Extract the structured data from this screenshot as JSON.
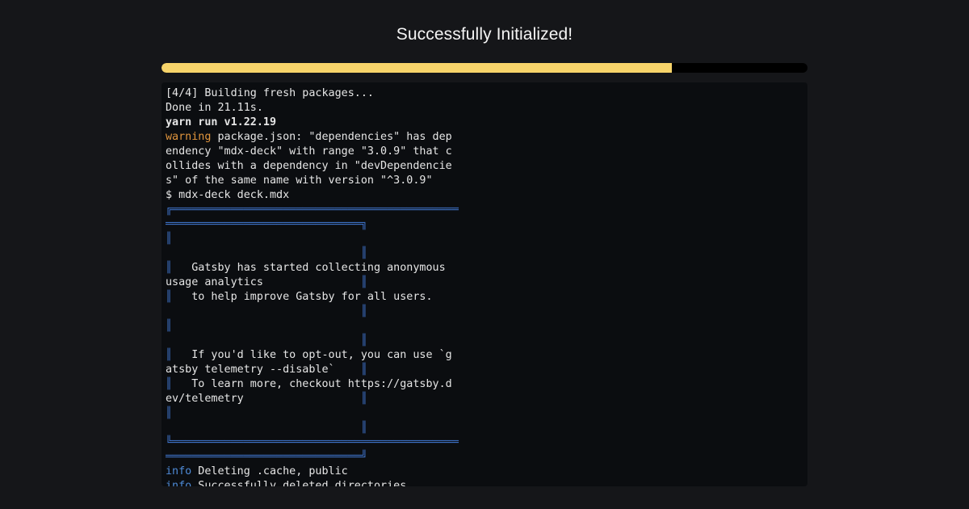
{
  "header": {
    "title": "Successfully Initialized!"
  },
  "progress": {
    "percent": 79
  },
  "terminal": {
    "lines": [
      {
        "segments": [
          {
            "text": "[4/4] Building fresh packages...",
            "style": "normal"
          }
        ]
      },
      {
        "segments": [
          {
            "text": "Done in 21.11s.",
            "style": "normal"
          }
        ]
      },
      {
        "segments": [
          {
            "text": "yarn run v1.22.19",
            "style": "bold"
          }
        ]
      },
      {
        "segments": [
          {
            "text": "warning",
            "style": "warn"
          },
          {
            "text": " package.json: \"dependencies\" has dep",
            "style": "normal"
          }
        ]
      },
      {
        "segments": [
          {
            "text": "endency \"mdx-deck\" with range \"3.0.9\" that c",
            "style": "normal"
          }
        ]
      },
      {
        "segments": [
          {
            "text": "ollides with a dependency in \"devDependencie",
            "style": "normal"
          }
        ]
      },
      {
        "segments": [
          {
            "text": "s\" of the same name with version \"^3.0.9\"",
            "style": "normal"
          }
        ]
      },
      {
        "segments": [
          {
            "text": "$ mdx-deck deck.mdx",
            "style": "normal"
          }
        ]
      },
      {
        "segments": [
          {
            "text": "╔════════════════════════════════════════════",
            "style": "box"
          }
        ]
      },
      {
        "segments": [
          {
            "text": "══════════════════════════════╗",
            "style": "box"
          }
        ]
      },
      {
        "segments": [
          {
            "text": "║",
            "style": "box"
          }
        ]
      },
      {
        "segments": [
          {
            "text": "                              ║",
            "style": "box"
          }
        ]
      },
      {
        "segments": [
          {
            "text": "║",
            "style": "box"
          },
          {
            "text": "   Gatsby has started collecting anonymous",
            "style": "normal"
          }
        ]
      },
      {
        "segments": [
          {
            "text": "usage analytics               ",
            "style": "normal"
          },
          {
            "text": "║",
            "style": "box"
          }
        ]
      },
      {
        "segments": [
          {
            "text": "║",
            "style": "box"
          },
          {
            "text": "   to help improve Gatsby for all users.",
            "style": "normal"
          }
        ]
      },
      {
        "segments": [
          {
            "text": "                              ║",
            "style": "box"
          }
        ]
      },
      {
        "segments": [
          {
            "text": "║",
            "style": "box"
          }
        ]
      },
      {
        "segments": [
          {
            "text": "                              ║",
            "style": "box"
          }
        ]
      },
      {
        "segments": [
          {
            "text": "║",
            "style": "box"
          },
          {
            "text": "   If you'd like to opt-out, you can use `g",
            "style": "normal"
          }
        ]
      },
      {
        "segments": [
          {
            "text": "atsby telemetry --disable`    ",
            "style": "normal"
          },
          {
            "text": "║",
            "style": "box"
          }
        ]
      },
      {
        "segments": [
          {
            "text": "║",
            "style": "box"
          },
          {
            "text": "   To learn more, checkout https://gatsby.d",
            "style": "normal"
          }
        ]
      },
      {
        "segments": [
          {
            "text": "ev/telemetry                  ",
            "style": "normal"
          },
          {
            "text": "║",
            "style": "box"
          }
        ]
      },
      {
        "segments": [
          {
            "text": "║",
            "style": "box"
          }
        ]
      },
      {
        "segments": [
          {
            "text": "                              ║",
            "style": "box"
          }
        ]
      },
      {
        "segments": [
          {
            "text": "╚════════════════════════════════════════════",
            "style": "box"
          }
        ]
      },
      {
        "segments": [
          {
            "text": "══════════════════════════════╝",
            "style": "box"
          }
        ]
      },
      {
        "segments": [
          {
            "text": "info",
            "style": "info"
          },
          {
            "text": " Deleting .cache, public",
            "style": "normal"
          }
        ]
      },
      {
        "segments": [
          {
            "text": "info",
            "style": "info"
          },
          {
            "text": " Successfully deleted directories",
            "style": "normal"
          }
        ]
      }
    ]
  },
  "colors": {
    "background": "#151619",
    "terminal_background": "#0b0d10",
    "progress_fill": "#f7d46a",
    "progress_track": "#000000",
    "warning": "#e0953d",
    "info": "#4e8ad6",
    "box_border": "#3c6fc2"
  }
}
